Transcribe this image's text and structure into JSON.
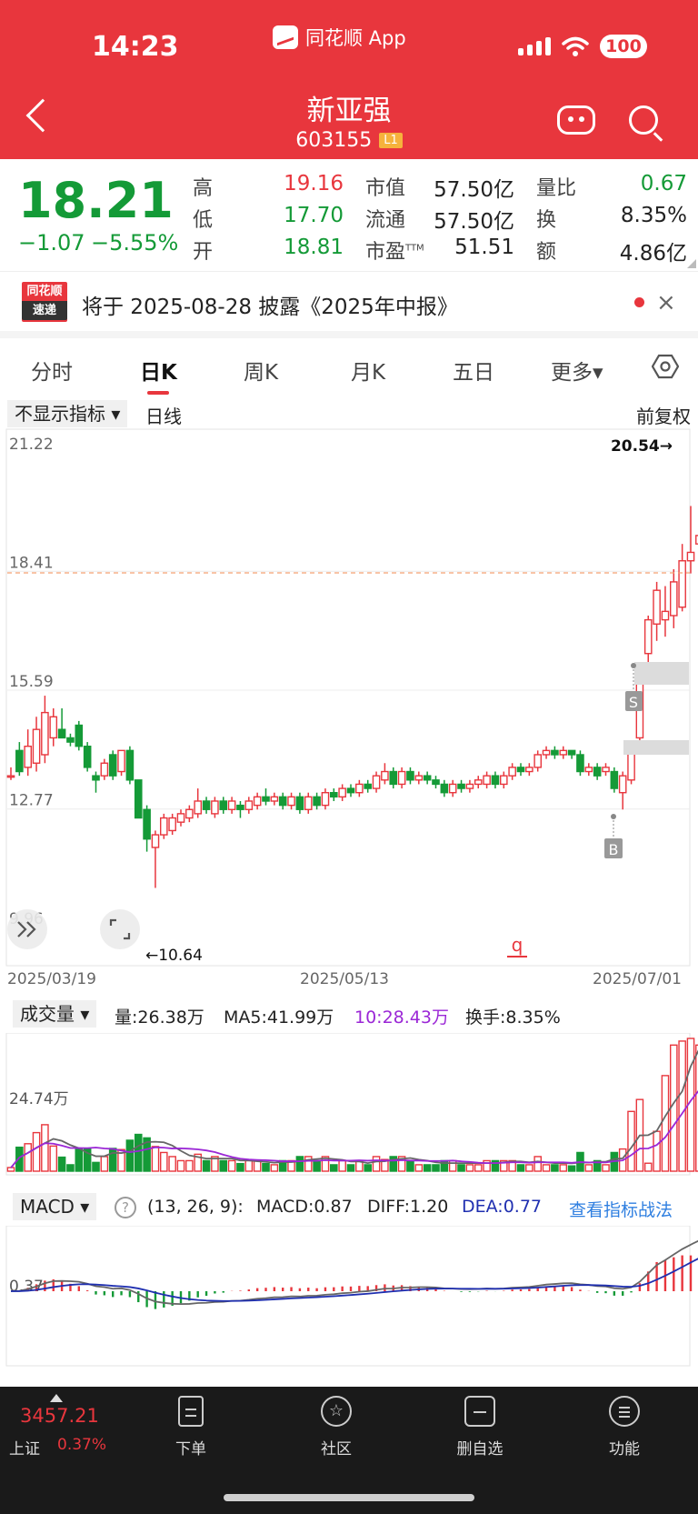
{
  "status_bar": {
    "time": "14:23",
    "app_name": "同花顺 App",
    "battery": "100"
  },
  "header": {
    "name": "新亚强",
    "code": "603155",
    "level": "L1"
  },
  "quote": {
    "price": "18.21",
    "change": "−1.07",
    "change_pct": "−5.55%",
    "high_label": "高",
    "high": "19.16",
    "low_label": "低",
    "low": "17.70",
    "open_label": "开",
    "open": "18.81",
    "mcap_label": "市值",
    "mcap": "57.50亿",
    "float_label": "流通",
    "float": "57.50亿",
    "pe_label": "市盈",
    "pe_sup": "TTM",
    "pe": "51.51",
    "vr_label": "量比",
    "vr": "0.67",
    "turnover_label": "换",
    "turnover": "8.35%",
    "amount_label": "额",
    "amount": "4.86亿"
  },
  "notice": {
    "logo_top": "同花顺",
    "logo_bottom": "速递",
    "text": "将于 2025-08-28 披露《2025年中报》",
    "close": "×"
  },
  "tabs": [
    "分时",
    "日K",
    "周K",
    "月K",
    "五日",
    "更多▾"
  ],
  "kline": {
    "indicator_select": "不显示指标 ▾",
    "period_label": "日线",
    "adjust_label": "前复权",
    "y_labels": [
      "21.22",
      "18.41",
      "15.59",
      "12.77",
      "9.96"
    ],
    "high_mark": "20.54→",
    "low_mark": "←10.64",
    "signal_s": "S",
    "signal_b": "B",
    "q_mark": "q",
    "dates": [
      "2025/03/19",
      "2025/05/13",
      "2025/07/01"
    ]
  },
  "volume": {
    "select": "成交量 ▾",
    "vol": "量:26.38万",
    "ma5": "MA5:41.99万",
    "ma10": "10:28.43万",
    "turnover": "换手:8.35%",
    "y_label": "24.74万"
  },
  "macd": {
    "select": "MACD ▾",
    "help": "?",
    "params": "(13, 26, 9):",
    "macd": "MACD:0.87",
    "diff": "DIFF:1.20",
    "dea": "DEA:0.77",
    "link": "查看指标战法",
    "y_label": "0.37"
  },
  "bottom_nav": {
    "index_value": "3457.21",
    "index_name": "上证",
    "index_pct": "0.37%",
    "items": [
      "下单",
      "社区",
      "删自选",
      "功能"
    ]
  },
  "colors": {
    "up": "#e8363d",
    "down": "#149a37",
    "header": "#e8363d",
    "link": "#2f7fe0",
    "ma10": "#9b27d6",
    "dea": "#1f2fb0"
  },
  "chart_data": {
    "type": "candlestick",
    "ylim": [
      9.96,
      21.22
    ],
    "candles": [
      {
        "o": 13.3,
        "c": 13.3,
        "h": 13.5,
        "l": 13.2
      },
      {
        "o": 13.9,
        "c": 13.4,
        "h": 14.1,
        "l": 13.3
      },
      {
        "o": 13.5,
        "c": 14.0,
        "h": 14.4,
        "l": 13.3
      },
      {
        "o": 13.6,
        "c": 14.4,
        "h": 14.7,
        "l": 13.4
      },
      {
        "o": 13.8,
        "c": 14.8,
        "h": 15.2,
        "l": 13.6
      },
      {
        "o": 14.2,
        "c": 14.7,
        "h": 14.9,
        "l": 14.0
      },
      {
        "o": 14.4,
        "c": 14.2,
        "h": 14.9,
        "l": 14.2
      },
      {
        "o": 14.2,
        "c": 14.1,
        "h": 14.3,
        "l": 14.0
      },
      {
        "o": 14.5,
        "c": 14.0,
        "h": 14.6,
        "l": 13.9
      },
      {
        "o": 14.0,
        "c": 13.5,
        "h": 14.1,
        "l": 13.4
      },
      {
        "o": 13.3,
        "c": 13.2,
        "h": 13.4,
        "l": 12.9
      },
      {
        "o": 13.3,
        "c": 13.6,
        "h": 13.7,
        "l": 13.2
      },
      {
        "o": 13.8,
        "c": 13.3,
        "h": 13.9,
        "l": 13.2
      },
      {
        "o": 13.4,
        "c": 13.9,
        "h": 13.9,
        "l": 13.3
      },
      {
        "o": 13.9,
        "c": 13.2,
        "h": 14.0,
        "l": 13.1
      },
      {
        "o": 13.2,
        "c": 12.3,
        "h": 13.2,
        "l": 12.3
      },
      {
        "o": 12.5,
        "c": 11.8,
        "h": 12.6,
        "l": 11.5
      },
      {
        "o": 11.6,
        "c": 11.9,
        "h": 12.0,
        "l": 10.64
      },
      {
        "o": 11.9,
        "c": 12.3,
        "h": 12.4,
        "l": 11.8
      },
      {
        "o": 12.0,
        "c": 12.3,
        "h": 12.4,
        "l": 11.9
      },
      {
        "o": 12.2,
        "c": 12.4,
        "h": 12.5,
        "l": 12.1
      },
      {
        "o": 12.3,
        "c": 12.5,
        "h": 12.6,
        "l": 12.2
      },
      {
        "o": 12.4,
        "c": 12.7,
        "h": 13.0,
        "l": 12.3
      },
      {
        "o": 12.7,
        "c": 12.5,
        "h": 12.8,
        "l": 12.4
      },
      {
        "o": 12.4,
        "c": 12.7,
        "h": 12.8,
        "l": 12.3
      },
      {
        "o": 12.7,
        "c": 12.5,
        "h": 12.8,
        "l": 12.4
      },
      {
        "o": 12.5,
        "c": 12.7,
        "h": 12.8,
        "l": 12.4
      },
      {
        "o": 12.6,
        "c": 12.5,
        "h": 12.7,
        "l": 12.3
      },
      {
        "o": 12.5,
        "c": 12.7,
        "h": 12.8,
        "l": 12.4
      },
      {
        "o": 12.6,
        "c": 12.8,
        "h": 12.9,
        "l": 12.5
      },
      {
        "o": 12.8,
        "c": 12.7,
        "h": 13.0,
        "l": 12.6
      },
      {
        "o": 12.7,
        "c": 12.8,
        "h": 12.9,
        "l": 12.6
      },
      {
        "o": 12.8,
        "c": 12.6,
        "h": 12.9,
        "l": 12.5
      },
      {
        "o": 12.6,
        "c": 12.8,
        "h": 12.9,
        "l": 12.5
      },
      {
        "o": 12.8,
        "c": 12.5,
        "h": 12.9,
        "l": 12.4
      },
      {
        "o": 12.5,
        "c": 12.8,
        "h": 12.9,
        "l": 12.4
      },
      {
        "o": 12.8,
        "c": 12.6,
        "h": 12.9,
        "l": 12.5
      },
      {
        "o": 12.6,
        "c": 12.9,
        "h": 13.0,
        "l": 12.5
      },
      {
        "o": 12.9,
        "c": 12.8,
        "h": 13.0,
        "l": 12.7
      },
      {
        "o": 12.8,
        "c": 13.0,
        "h": 13.1,
        "l": 12.7
      },
      {
        "o": 13.0,
        "c": 12.9,
        "h": 13.1,
        "l": 12.8
      },
      {
        "o": 12.9,
        "c": 13.1,
        "h": 13.2,
        "l": 12.8
      },
      {
        "o": 13.1,
        "c": 13.0,
        "h": 13.2,
        "l": 12.9
      },
      {
        "o": 13.0,
        "c": 13.3,
        "h": 13.4,
        "l": 12.9
      },
      {
        "o": 13.2,
        "c": 13.4,
        "h": 13.6,
        "l": 13.1
      },
      {
        "o": 13.4,
        "c": 13.1,
        "h": 13.5,
        "l": 13.0
      },
      {
        "o": 13.1,
        "c": 13.4,
        "h": 13.5,
        "l": 13.0
      },
      {
        "o": 13.4,
        "c": 13.2,
        "h": 13.5,
        "l": 13.1
      },
      {
        "o": 13.2,
        "c": 13.3,
        "h": 13.4,
        "l": 13.1
      },
      {
        "o": 13.3,
        "c": 13.2,
        "h": 13.4,
        "l": 13.1
      },
      {
        "o": 13.2,
        "c": 13.1,
        "h": 13.3,
        "l": 13.0
      },
      {
        "o": 13.1,
        "c": 12.9,
        "h": 13.2,
        "l": 12.8
      },
      {
        "o": 12.9,
        "c": 13.1,
        "h": 13.2,
        "l": 12.8
      },
      {
        "o": 13.1,
        "c": 13.0,
        "h": 13.2,
        "l": 12.9
      },
      {
        "o": 13.0,
        "c": 13.1,
        "h": 13.2,
        "l": 12.9
      },
      {
        "o": 13.1,
        "c": 13.2,
        "h": 13.3,
        "l": 13.0
      },
      {
        "o": 13.1,
        "c": 13.3,
        "h": 13.4,
        "l": 13.0
      },
      {
        "o": 13.3,
        "c": 13.1,
        "h": 13.4,
        "l": 13.0
      },
      {
        "o": 13.1,
        "c": 13.3,
        "h": 13.4,
        "l": 13.0
      },
      {
        "o": 13.3,
        "c": 13.5,
        "h": 13.6,
        "l": 13.2
      },
      {
        "o": 13.5,
        "c": 13.4,
        "h": 13.6,
        "l": 13.3
      },
      {
        "o": 13.4,
        "c": 13.5,
        "h": 13.6,
        "l": 13.3
      },
      {
        "o": 13.5,
        "c": 13.8,
        "h": 13.9,
        "l": 13.4
      },
      {
        "o": 13.8,
        "c": 13.9,
        "h": 14.0,
        "l": 13.7
      },
      {
        "o": 13.9,
        "c": 13.8,
        "h": 14.0,
        "l": 13.7
      },
      {
        "o": 13.8,
        "c": 13.9,
        "h": 14.0,
        "l": 13.7
      },
      {
        "o": 13.9,
        "c": 13.8,
        "h": 13.9,
        "l": 13.7
      },
      {
        "o": 13.8,
        "c": 13.4,
        "h": 13.9,
        "l": 13.3
      },
      {
        "o": 13.4,
        "c": 13.5,
        "h": 13.6,
        "l": 13.3
      },
      {
        "o": 13.5,
        "c": 13.3,
        "h": 13.6,
        "l": 13.2
      },
      {
        "o": 13.4,
        "c": 13.5,
        "h": 13.6,
        "l": 13.3
      },
      {
        "o": 13.4,
        "c": 13.0,
        "h": 13.5,
        "l": 12.9
      },
      {
        "o": 12.9,
        "c": 13.3,
        "h": 13.4,
        "l": 12.5
      },
      {
        "o": 13.2,
        "c": 14.0,
        "h": 14.1,
        "l": 13.1
      },
      {
        "o": 14.2,
        "c": 15.6,
        "h": 15.7,
        "l": 14.1
      },
      {
        "o": 16.2,
        "c": 17.0,
        "h": 17.1,
        "l": 16.0
      },
      {
        "o": 16.9,
        "c": 17.7,
        "h": 17.9,
        "l": 16.5
      },
      {
        "o": 17.0,
        "c": 17.2,
        "h": 17.8,
        "l": 16.6
      },
      {
        "o": 17.1,
        "c": 17.9,
        "h": 18.2,
        "l": 16.8
      },
      {
        "o": 17.3,
        "c": 18.4,
        "h": 18.8,
        "l": 17.2
      },
      {
        "o": 18.4,
        "c": 18.6,
        "h": 19.7,
        "l": 18.1
      },
      {
        "o": 18.8,
        "c": 19.0,
        "h": 20.54,
        "l": 18.3
      },
      {
        "o": 18.81,
        "c": 18.21,
        "h": 19.16,
        "l": 17.7
      }
    ]
  }
}
